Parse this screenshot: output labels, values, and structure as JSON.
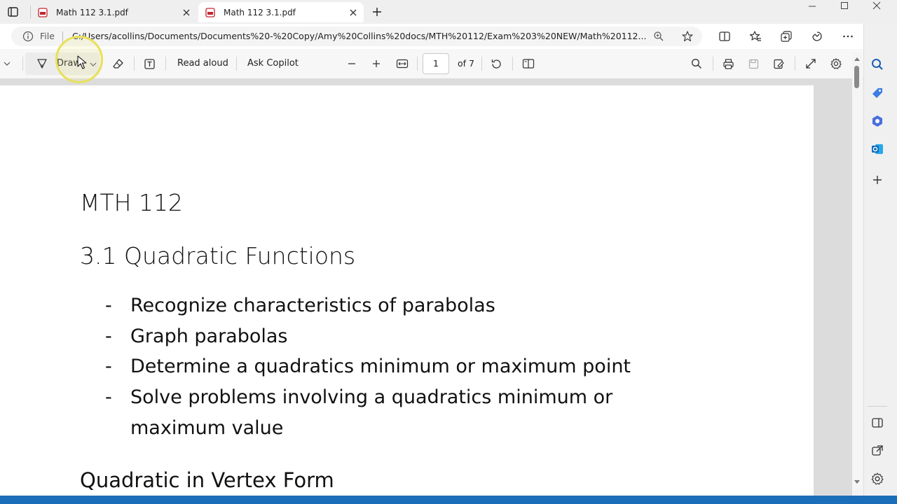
{
  "tabs": [
    {
      "title": "Math 112 3.1.pdf",
      "active": false
    },
    {
      "title": "Math 112 3.1.pdf",
      "active": true
    }
  ],
  "address": {
    "file_label": "File",
    "url": "C:/Users/acollins/Documents/Documents%20-%20Copy/Amy%20Collins%20docs/MTH%20112/Exam%203%20NEW/Math%20112..."
  },
  "toolbar": {
    "draw_label": "Draw",
    "read_aloud_label": "Read aloud",
    "ask_copilot_label": "Ask Copilot",
    "page_current": "1",
    "page_total_label": "of 7"
  },
  "document": {
    "course": "MTH 112",
    "section": "3.1 Quadratic Functions",
    "bullets": [
      "Recognize characteristics of parabolas",
      "Graph parabolas",
      "Determine a quadratics minimum or maximum point",
      "Solve problems involving a quadratics minimum or",
      "maximum value"
    ],
    "next_heading": "Quadratic in Vertex Form"
  },
  "colors": {
    "accent": "#1b6fb8",
    "highlight": "#e8e05a",
    "pdf_icon": "#c4262e"
  },
  "icons": {
    "sidebar": [
      "search-icon",
      "tag-icon",
      "copilot-apps-icon",
      "outlook-icon",
      "add-icon",
      "split-screen-icon",
      "external-link-icon",
      "settings-icon"
    ]
  }
}
